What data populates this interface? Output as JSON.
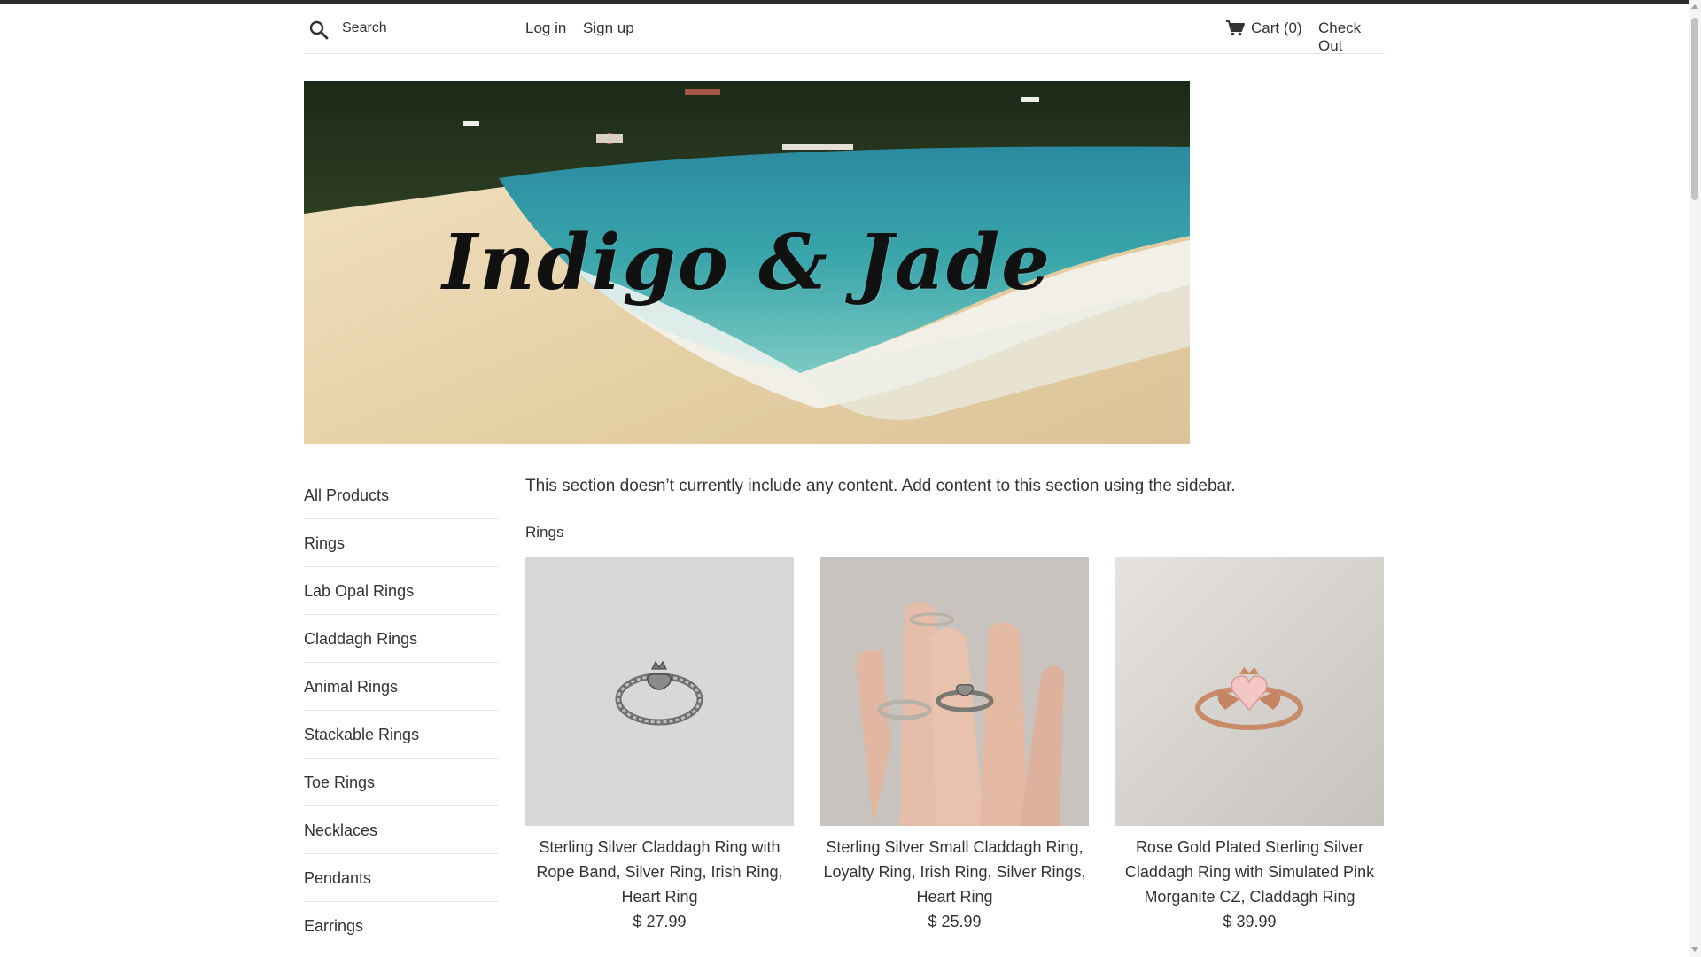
{
  "header": {
    "search_placeholder": "Search",
    "login_label": "Log in",
    "signup_label": "Sign up",
    "cart_label": "Cart (0)",
    "checkout_label": "Check Out"
  },
  "banner": {
    "title": "Indigo & Jade"
  },
  "sidebar": {
    "items": [
      {
        "label": "All Products"
      },
      {
        "label": "Rings"
      },
      {
        "label": "Lab Opal Rings"
      },
      {
        "label": "Claddagh Rings"
      },
      {
        "label": "Animal Rings"
      },
      {
        "label": "Stackable Rings"
      },
      {
        "label": "Toe Rings"
      },
      {
        "label": "Necklaces"
      },
      {
        "label": "Pendants"
      },
      {
        "label": "Earrings"
      }
    ]
  },
  "main": {
    "notice": "This section doesn’t currently include any content. Add content to this section using the sidebar.",
    "section_title": "Rings",
    "products": [
      {
        "title": "Sterling Silver Claddagh Ring with Rope Band, Silver Ring, Irish Ring, Heart Ring",
        "price": "$ 27.99"
      },
      {
        "title": "Sterling Silver Small Claddagh Ring, Loyalty Ring, Irish Ring, Silver Rings, Heart Ring",
        "price": "$ 25.99"
      },
      {
        "title": "Rose Gold Plated Sterling Silver Claddagh Ring with Simulated Pink Morganite CZ, Claddagh Ring",
        "price": "$ 39.99"
      }
    ]
  },
  "colors": {
    "text": "#333333",
    "divider": "#e4e4e4",
    "top_bar": "#2a2a2a"
  }
}
